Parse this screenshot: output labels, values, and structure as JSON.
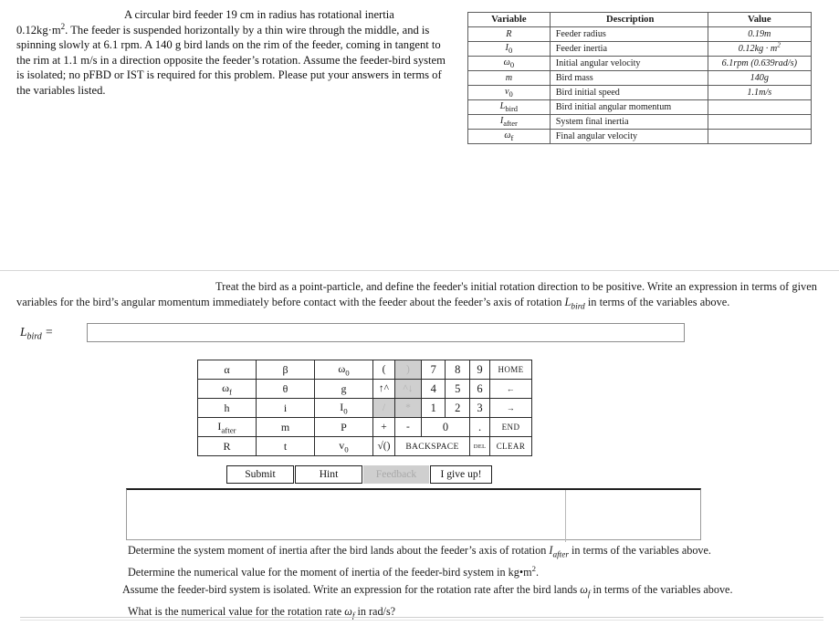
{
  "problem": {
    "indent_text": "A circular bird feeder 19 cm in radius has rotational inertia",
    "body_lines": [
      "0.12kg·m2. The feeder is suspended horizontally by a thin wire through the middle,",
      "and is spinning slowly at 6.1 rpm. A 140 g bird lands on the rim of the feeder, coming",
      "in tangent to the rim at 1.1 m/s in a direction opposite the feeder's rotation. Assume",
      "the feeder-bird system is isolated; no pFBD or IST is required for this problem. Please",
      "put your answers in terms of the variables listed."
    ],
    "full_text": "A circular bird feeder 19 cm in radius has rotational inertia 0.12kg·m². The feeder is suspended horizontally by a thin wire through the middle, and is spinning slowly at 6.1 rpm. A 140 g bird lands on the rim of the feeder, coming in tangent to the rim at 1.1 m/s in a direction opposite the feeder's rotation. Assume the feeder-bird system is isolated; no pFBD or IST is required for this problem. Please put your answers in terms of the variables listed."
  },
  "variable_table": {
    "headers": [
      "Variable",
      "Description",
      "Value"
    ],
    "rows": [
      {
        "variable": "R",
        "sub": "",
        "description": "Feeder radius",
        "value": "0.19m"
      },
      {
        "variable": "I",
        "sub": "0",
        "description": "Feeder inertia",
        "value": "0.12kg · m2"
      },
      {
        "variable": "ω",
        "sub": "0",
        "description": "Initial angular velocity",
        "value": "6.1rpm  (0.639rad/s)"
      },
      {
        "variable": "m",
        "sub": "",
        "description": "Bird mass",
        "value": "140g"
      },
      {
        "variable": "v",
        "sub": "0",
        "description": "Bird initial speed",
        "value": "1.1m/s"
      },
      {
        "variable": "L",
        "sub": "bird",
        "description": "Bird initial angular momentum",
        "value": ""
      },
      {
        "variable": "I",
        "sub": "after",
        "description": "System final inertia",
        "value": ""
      },
      {
        "variable": "ω",
        "sub": "f",
        "description": "Final angular velocity",
        "value": ""
      }
    ]
  },
  "part_a": {
    "indent_text": "Treat the bird as a point-particle, and define the feeder's initial rotation direction to be positive. Write an expression in terms of given",
    "continuation": "variables for the bird's angular momentum immediately before contact with the feeder about the feeder's axis of rotation Lbird in terms of the variables above.",
    "answer_label_base": "L",
    "answer_label_sub": "bird",
    "answer_label_equals": " =",
    "answer_value": "",
    "answer_placeholder": ""
  },
  "keypad": {
    "rows": [
      {
        "vars": [
          {
            "base": "α",
            "sub": "",
            "enabled": true
          },
          {
            "base": "β",
            "sub": "",
            "enabled": true
          },
          {
            "base": "ω",
            "sub": "0",
            "enabled": true
          }
        ],
        "ops": [
          {
            "label": "(",
            "enabled": true
          },
          {
            "label": ")",
            "enabled": false
          }
        ],
        "nums": [
          "7",
          "8",
          "9"
        ],
        "nav": {
          "label": "HOME",
          "enabled": true
        }
      },
      {
        "vars": [
          {
            "base": "ω",
            "sub": "f",
            "enabled": true
          },
          {
            "base": "θ",
            "sub": "",
            "enabled": true
          },
          {
            "base": "g",
            "sub": "",
            "enabled": true
          }
        ],
        "ops": [
          {
            "label": "↑^",
            "enabled": true
          },
          {
            "label": "^↓",
            "enabled": false
          }
        ],
        "nums": [
          "4",
          "5",
          "6"
        ],
        "nav": {
          "label": "←",
          "enabled": true
        }
      },
      {
        "vars": [
          {
            "base": "h",
            "sub": "",
            "enabled": true
          },
          {
            "base": "i",
            "sub": "",
            "enabled": true
          },
          {
            "base": "I",
            "sub": "0",
            "enabled": true
          }
        ],
        "ops": [
          {
            "label": "/",
            "enabled": false
          },
          {
            "label": "*",
            "enabled": false
          }
        ],
        "nums": [
          "1",
          "2",
          "3"
        ],
        "nav": {
          "label": "→",
          "enabled": true
        }
      },
      {
        "vars": [
          {
            "base": "I",
            "sub": "after",
            "enabled": true
          },
          {
            "base": "m",
            "sub": "",
            "enabled": true
          },
          {
            "base": "P",
            "sub": "",
            "enabled": true
          }
        ],
        "ops": [
          {
            "label": "+",
            "enabled": true
          },
          {
            "label": "-",
            "enabled": true
          }
        ],
        "zero": "0",
        "dot": ".",
        "nav": {
          "label": "END",
          "enabled": true
        }
      },
      {
        "vars": [
          {
            "base": "R",
            "sub": "",
            "enabled": true
          },
          {
            "base": "t",
            "sub": "",
            "enabled": true
          },
          {
            "base": "v",
            "sub": "0",
            "enabled": true
          }
        ],
        "sqrt": "√()",
        "backspace": "BACKSPACE",
        "del": "DEL",
        "nav": {
          "label": "CLEAR",
          "enabled": true
        }
      }
    ]
  },
  "buttons": {
    "submit": "Submit",
    "hint": "Hint",
    "feedback": "Feedback",
    "giveup": "I give up!"
  },
  "bottom_questions": [
    "Determine the system moment of inertia after the bird lands about the feeder's axis of rotation Iafter in terms of the variables above.",
    "Determine the numerical value for the moment of inertia of the feeder-bird system in kg•m2.",
    "Assume the feeder-bird system is isolated. Write an expression for the rotation rate after the bird lands ωf in terms of the variables above.",
    "What is the numerical value for the rotation rate ωf in rad/s?"
  ],
  "colors": {
    "page_background": "#ffffff",
    "text": "#1a1a1a",
    "table_border": "#5c5c5c",
    "keypad_border": "#2b2b2b",
    "disabled_background": "#cfcfcf",
    "disabled_text": "#b3b3b3",
    "input_border": "#8d8d8d",
    "divider": "#d7d7d7"
  }
}
